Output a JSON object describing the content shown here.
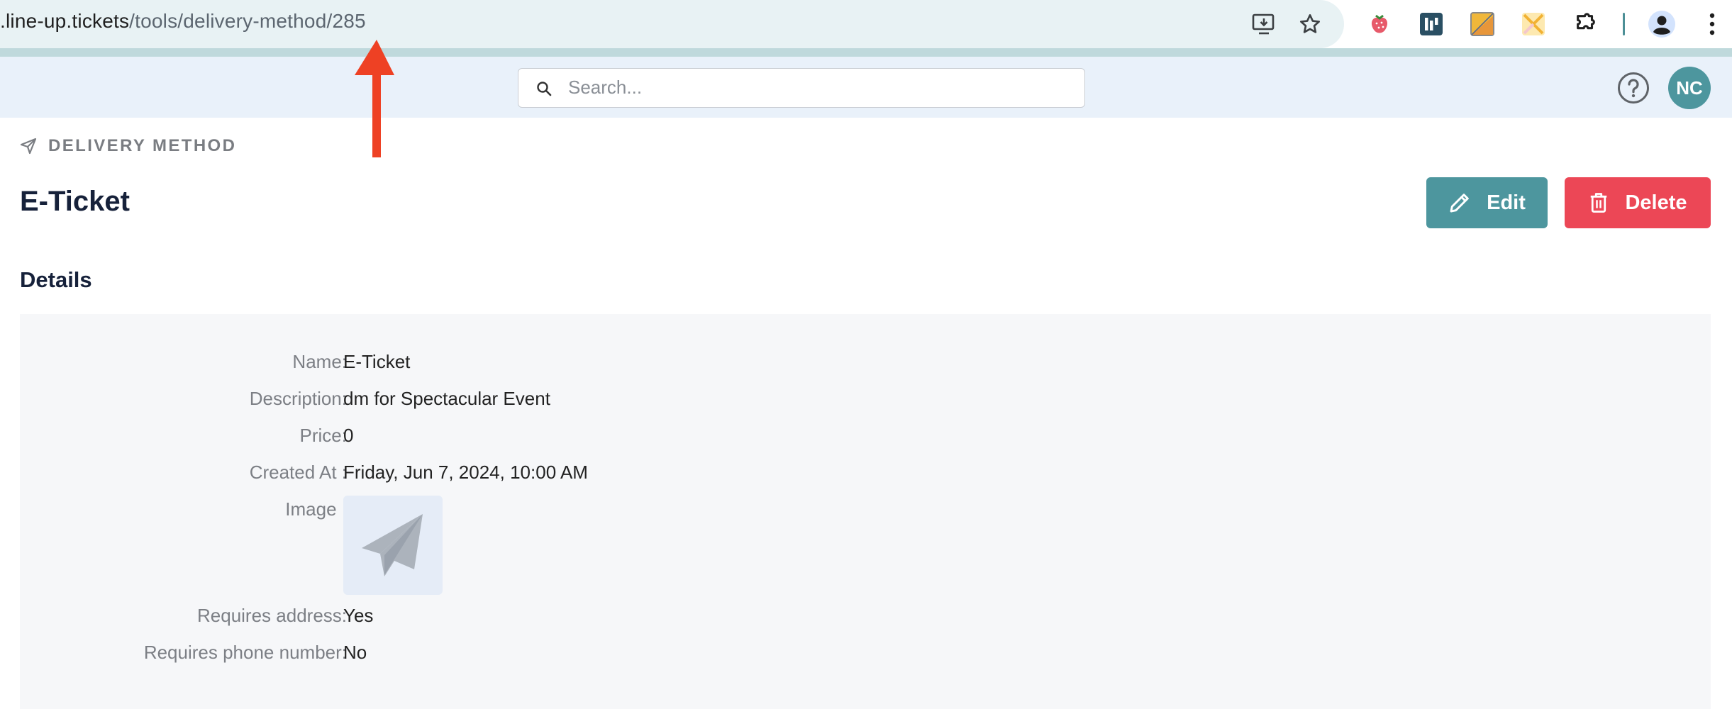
{
  "browser": {
    "url_host": ".line-up.tickets",
    "url_path": "/tools/delivery-method/285",
    "icons": [
      "install-app-icon",
      "bookmark-star-icon",
      "strawberry-extension-icon",
      "dark-extension-icon",
      "yellow-extension-icon",
      "sparkle-extension-icon",
      "puzzle-extensions-icon",
      "profile-icon",
      "kebab-menu-icon"
    ]
  },
  "header": {
    "search_placeholder": "Search...",
    "avatar_initials": "NC",
    "accent_color": "#4d969e"
  },
  "annotation": {
    "arrow_color": "#ee4124"
  },
  "breadcrumb": {
    "label": "DELIVERY METHOD"
  },
  "page": {
    "title": "E-Ticket",
    "edit_label": "Edit",
    "delete_label": "Delete",
    "delete_color": "#ec4756"
  },
  "details": {
    "section_title": "Details",
    "name_label": "Name:",
    "name_value": "E-Ticket",
    "description_label": "Description:",
    "description_value": "dm for Spectacular Event",
    "price_label": "Price:",
    "price_value": "0",
    "created_label": "Created At :",
    "created_value": "Friday, Jun 7, 2024, 10:00 AM",
    "image_label": "Image :",
    "requires_address_label": "Requires address:",
    "requires_address_value": "Yes",
    "requires_phone_label": "Requires phone number:",
    "requires_phone_value": "No"
  }
}
